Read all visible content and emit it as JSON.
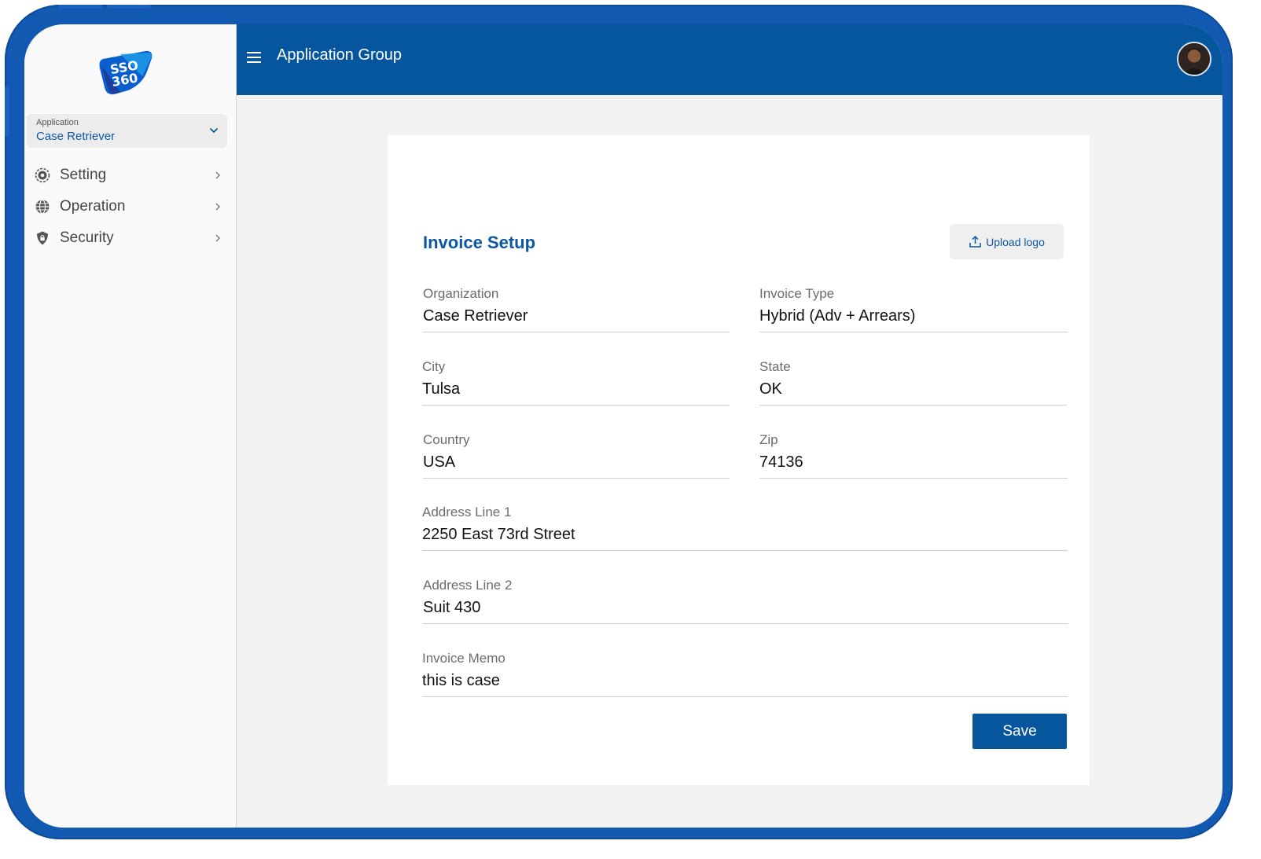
{
  "app": {
    "logo_alt": "SSO 360"
  },
  "sidebar": {
    "app_selector": {
      "label": "Application",
      "value": "Case Retriever"
    },
    "items": [
      {
        "label": "Setting",
        "icon": "gear-icon"
      },
      {
        "label": "Operation",
        "icon": "globe-icon"
      },
      {
        "label": "Security",
        "icon": "shield-lock-icon"
      }
    ]
  },
  "header": {
    "title": "Application Group"
  },
  "form": {
    "title": "Invoice Setup",
    "upload_label": "Upload logo",
    "fields": {
      "organization": {
        "label": "Organization",
        "value": "Case Retriever"
      },
      "invoice_type": {
        "label": "Invoice Type",
        "value": "Hybrid (Adv + Arrears)"
      },
      "city": {
        "label": "City",
        "value": "Tulsa"
      },
      "state": {
        "label": "State",
        "value": "OK"
      },
      "country": {
        "label": "Country",
        "value": "USA"
      },
      "zip": {
        "label": "Zip",
        "value": "74136"
      },
      "address1": {
        "label": "Address Line 1",
        "value": "2250 East 73rd Street"
      },
      "address2": {
        "label": "Address Line 2",
        "value": "Suit 430"
      },
      "memo": {
        "label": "Invoice Memo",
        "value": "this is case"
      }
    },
    "save_label": "Save"
  },
  "colors": {
    "primary": "#06569e",
    "accent_text": "#0b57a4",
    "frame": "#1259b2",
    "background": "#f2f2f2"
  }
}
